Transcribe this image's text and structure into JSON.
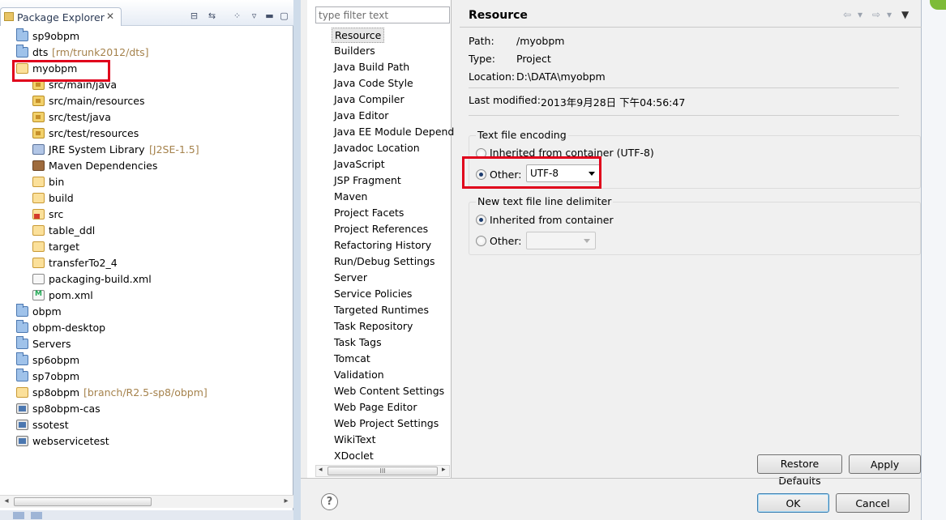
{
  "package_explorer": {
    "title": "Package Explorer",
    "close_glyph": "✕",
    "toolbar_icons": [
      "collapse-all-icon",
      "link-with-editor-icon",
      "focus-icon",
      "view-menu-icon",
      "minimize-icon",
      "maximize-icon"
    ],
    "items": [
      {
        "label": "sp9obpm",
        "decor": "",
        "icon": "project-icon"
      },
      {
        "label": "dts",
        "decor": "[rm/trunk2012/dts]",
        "icon": "project-icon"
      },
      {
        "label": "myobpm",
        "decor": "",
        "icon": "maven-project-icon"
      },
      {
        "label": "src/main/java",
        "decor": "",
        "icon": "source-folder-icon"
      },
      {
        "label": "src/main/resources",
        "decor": "",
        "icon": "source-folder-icon"
      },
      {
        "label": "src/test/java",
        "decor": "",
        "icon": "source-folder-icon"
      },
      {
        "label": "src/test/resources",
        "decor": "",
        "icon": "source-folder-icon"
      },
      {
        "label": "JRE System Library",
        "decor": "[J2SE-1.5]",
        "icon": "library-icon"
      },
      {
        "label": "Maven Dependencies",
        "decor": "",
        "icon": "maven-library-icon"
      },
      {
        "label": "bin",
        "decor": "",
        "icon": "folder-icon"
      },
      {
        "label": "build",
        "decor": "",
        "icon": "folder-icon"
      },
      {
        "label": "src",
        "decor": "",
        "icon": "source-error-icon"
      },
      {
        "label": "table_ddl",
        "decor": "",
        "icon": "folder-icon"
      },
      {
        "label": "target",
        "decor": "",
        "icon": "folder-icon"
      },
      {
        "label": "transferTo2_4",
        "decor": "",
        "icon": "folder-icon"
      },
      {
        "label": "packaging-build.xml",
        "decor": "",
        "icon": "xml-file-icon"
      },
      {
        "label": "pom.xml",
        "decor": "",
        "icon": "pom-file-icon"
      },
      {
        "label": "obpm",
        "decor": "",
        "icon": "project-icon"
      },
      {
        "label": "obpm-desktop",
        "decor": "",
        "icon": "project-icon"
      },
      {
        "label": "Servers",
        "decor": "",
        "icon": "project-icon"
      },
      {
        "label": "sp6obpm",
        "decor": "",
        "icon": "project-icon"
      },
      {
        "label": "sp7obpm",
        "decor": "",
        "icon": "project-icon"
      },
      {
        "label": "sp8obpm",
        "decor": "[branch/R2.5-sp8/obpm]",
        "icon": "maven-project-icon"
      },
      {
        "label": "sp8obpm-cas",
        "decor": "",
        "icon": "web-project-icon"
      },
      {
        "label": "ssotest",
        "decor": "",
        "icon": "web-project-icon"
      },
      {
        "label": "webservicetest",
        "decor": "",
        "icon": "web-project-icon"
      }
    ]
  },
  "dialog": {
    "filter_placeholder": "type filter text",
    "nav_items": [
      "Resource",
      "Builders",
      "Java Build Path",
      "Java Code Style",
      "Java Compiler",
      "Java Editor",
      "Java EE Module Depend",
      "Javadoc Location",
      "JavaScript",
      "JSP Fragment",
      "Maven",
      "Project Facets",
      "Project References",
      "Refactoring History",
      "Run/Debug Settings",
      "Server",
      "Service Policies",
      "Targeted Runtimes",
      "Task Repository",
      "Task Tags",
      "Tomcat",
      "Validation",
      "Web Content Settings",
      "Web Page Editor",
      "Web Project Settings",
      "WikiText",
      "XDoclet"
    ],
    "selected_nav": "Resource",
    "scroll_grip": "III",
    "page": {
      "title": "Resource",
      "path_label": "Path:",
      "path_value": "/myobpm",
      "type_label": "Type:",
      "type_value": "Project",
      "location_label": "Location:",
      "location_value": "D:\\DATA\\myobpm",
      "last_modified_label": "Last modified:",
      "last_modified_value": "2013年9月28日 下午04:56:47",
      "encoding": {
        "title": "Text file encoding",
        "inherited_label": "Inherited from container (UTF-8)",
        "other_label": "Other:",
        "other_value": "UTF-8",
        "selected": "other"
      },
      "delimiter": {
        "title": "New text file line delimiter",
        "inherited_label": "Inherited from container",
        "other_label": "Other:",
        "other_value": "",
        "selected": "inherited"
      }
    },
    "buttons": {
      "restore_defaults": "Restore Defaults",
      "apply": "Apply",
      "ok": "OK",
      "cancel": "Cancel"
    },
    "help_glyph": "?"
  },
  "colors": {
    "highlight": "#e0001b",
    "decorator": "#a5824c"
  }
}
